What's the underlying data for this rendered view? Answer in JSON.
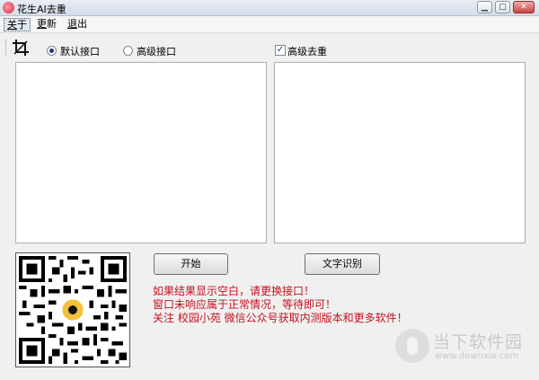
{
  "window": {
    "title": "花生AI去重"
  },
  "menu": {
    "items": [
      "关于",
      "更新",
      "退出"
    ]
  },
  "toolbar": {
    "radio_default": "默认接口",
    "radio_advanced": "高级接口",
    "checkbox_label": "高级去重",
    "icons": {
      "crop": "crop-icon"
    }
  },
  "buttons": {
    "start": "开始",
    "ocr": "文字识别"
  },
  "messages": [
    "如果结果显示空白，请更换接口！",
    "窗口未响应属于正常情况，等待即可！",
    "关注 校园小苑 微信公众号获取内测版本和更多软件！"
  ],
  "colors": {
    "message": "#c8101e",
    "accent": "#1e3a78"
  },
  "watermark": {
    "text": "当下软件园",
    "url": "www.downxia.com"
  }
}
